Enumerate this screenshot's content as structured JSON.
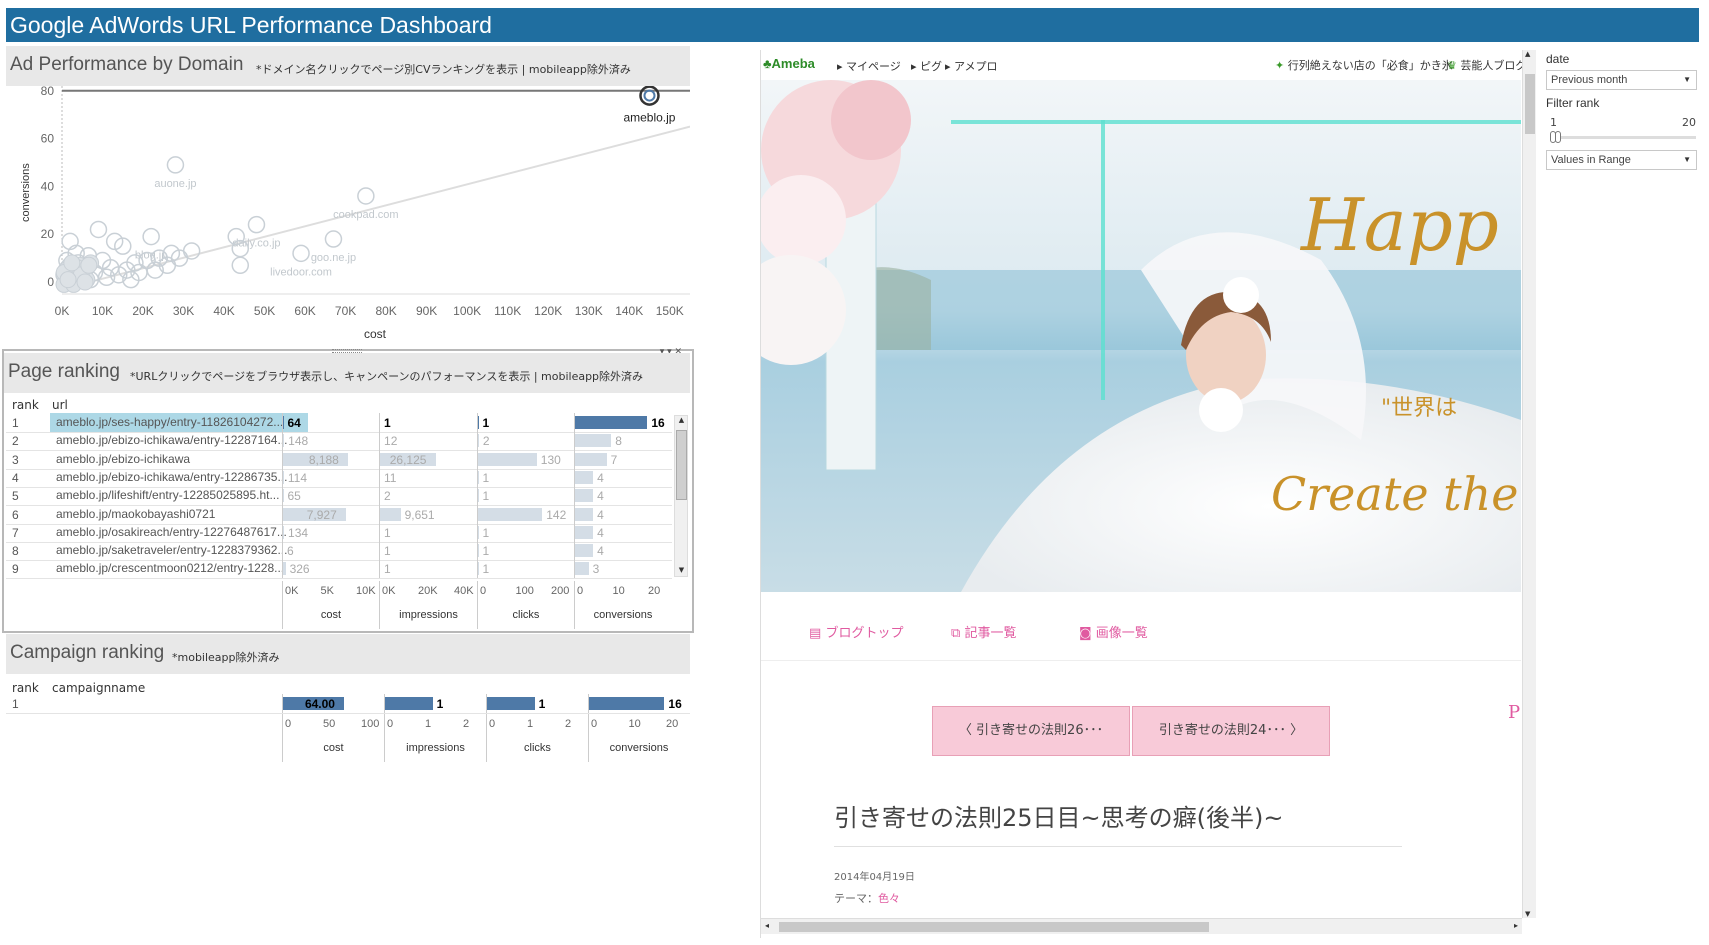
{
  "app": {
    "title": "Google AdWords URL Performance Dashboard"
  },
  "domain_panel": {
    "title": "Ad Performance by Domain",
    "subtitle": "*ドメイン名クリックでページ別CVランキングを表示 | mobileapp除外済み"
  },
  "chart_data": {
    "type": "scatter",
    "xlabel": "cost",
    "ylabel": "conversions",
    "xlim": [
      0,
      155000
    ],
    "ylim": [
      -5,
      82
    ],
    "x_ticks": [
      "0K",
      "10K",
      "20K",
      "30K",
      "40K",
      "50K",
      "60K",
      "70K",
      "80K",
      "90K",
      "100K",
      "110K",
      "120K",
      "130K",
      "140K",
      "150K"
    ],
    "y_ticks": [
      "80",
      "60",
      "40",
      "20",
      "0"
    ],
    "reference_line_y": 80,
    "trend_line": {
      "x": [
        0,
        155000
      ],
      "y": [
        -3,
        65
      ]
    },
    "highlight": {
      "label": "ameblo.jp",
      "x": 145000,
      "y": 78
    },
    "points": [
      {
        "label": "auone.jp",
        "x": 28000,
        "y": 49
      },
      {
        "label": "daily.co.jp",
        "x": 48000,
        "y": 24
      },
      {
        "label": "cookpad.com",
        "x": 75000,
        "y": 36
      },
      {
        "label": "blog.jp",
        "x": 22000,
        "y": 19
      },
      {
        "label": "goo.ne.jp",
        "x": 67000,
        "y": 18
      },
      {
        "label": "livedoor.com",
        "x": 59000,
        "y": 12
      },
      {
        "label": "",
        "x": 43000,
        "y": 19
      },
      {
        "label": "",
        "x": 44000,
        "y": 14
      },
      {
        "label": "",
        "x": 44000,
        "y": 7
      },
      {
        "label": "",
        "x": 9000,
        "y": 22
      },
      {
        "label": "",
        "x": 13000,
        "y": 17
      },
      {
        "label": "",
        "x": 15000,
        "y": 15
      },
      {
        "label": "",
        "x": 2000,
        "y": 17
      },
      {
        "label": "",
        "x": 32000,
        "y": 13
      },
      {
        "label": "",
        "x": 27000,
        "y": 12
      },
      {
        "label": "",
        "x": 24000,
        "y": 10
      },
      {
        "label": "",
        "x": 21000,
        "y": 9
      },
      {
        "label": "",
        "x": 18000,
        "y": 8
      },
      {
        "label": "",
        "x": 16000,
        "y": 5
      },
      {
        "label": "",
        "x": 12000,
        "y": 6
      },
      {
        "label": "",
        "x": 10000,
        "y": 9
      },
      {
        "label": "",
        "x": 8000,
        "y": 4
      },
      {
        "label": "",
        "x": 6000,
        "y": 6
      },
      {
        "label": "",
        "x": 5000,
        "y": 3
      },
      {
        "label": "",
        "x": 4000,
        "y": 8
      },
      {
        "label": "",
        "x": 3000,
        "y": 5
      },
      {
        "label": "",
        "x": 2500,
        "y": 2
      },
      {
        "label": "",
        "x": 2000,
        "y": 7
      },
      {
        "label": "",
        "x": 1500,
        "y": 4
      },
      {
        "label": "",
        "x": 1000,
        "y": 1
      },
      {
        "label": "",
        "x": 500,
        "y": 3
      },
      {
        "label": "",
        "x": 1200,
        "y": 9
      },
      {
        "label": "",
        "x": 7000,
        "y": 1
      },
      {
        "label": "",
        "x": 11000,
        "y": 2
      },
      {
        "label": "",
        "x": 14000,
        "y": 3
      },
      {
        "label": "",
        "x": 19000,
        "y": 4
      },
      {
        "label": "",
        "x": 23000,
        "y": 5
      },
      {
        "label": "",
        "x": 26000,
        "y": 7
      },
      {
        "label": "",
        "x": 29000,
        "y": 10
      },
      {
        "label": "",
        "x": 3500,
        "y": 12
      },
      {
        "label": "",
        "x": 6500,
        "y": 11
      },
      {
        "label": "",
        "x": 17000,
        "y": 1
      }
    ]
  },
  "page_ranking": {
    "title": "Page ranking",
    "subtitle": "*URLクリックでページをブラウザ表示し、キャンペーンのパフォーマンスを表示 | mobileapp除外済み",
    "headers": {
      "rank": "rank",
      "url": "url"
    },
    "measures": [
      "cost",
      "impressions",
      "clicks",
      "conversions"
    ],
    "axis_ticks": {
      "cost": [
        "0K",
        "5K",
        "10K"
      ],
      "impressions": [
        "0K",
        "20K",
        "40K"
      ],
      "clicks": [
        "0",
        "100",
        "200"
      ],
      "conversions": [
        "0",
        "10",
        "20"
      ]
    },
    "rows": [
      {
        "rank": "1",
        "url": "ameblo.jp/ses-happy/entry-11826104272...",
        "cost": "64",
        "impressions": "1",
        "clicks": "1",
        "conversions": "16",
        "cost_v": 64,
        "imp_v": 1,
        "clk_v": 1,
        "cv_v": 16
      },
      {
        "rank": "2",
        "url": "ameblo.jp/ebizo-ichikawa/entry-12287164...",
        "cost": "148",
        "impressions": "12",
        "clicks": "2",
        "conversions": "8",
        "cost_v": 148,
        "imp_v": 12,
        "clk_v": 2,
        "cv_v": 8
      },
      {
        "rank": "3",
        "url": "ameblo.jp/ebizo-ichikawa",
        "cost": "8,188",
        "impressions": "26,125",
        "clicks": "130",
        "conversions": "7",
        "cost_v": 8188,
        "imp_v": 26125,
        "clk_v": 130,
        "cv_v": 7
      },
      {
        "rank": "4",
        "url": "ameblo.jp/ebizo-ichikawa/entry-12286735...",
        "cost": "114",
        "impressions": "11",
        "clicks": "1",
        "conversions": "4",
        "cost_v": 114,
        "imp_v": 11,
        "clk_v": 1,
        "cv_v": 4
      },
      {
        "rank": "5",
        "url": "ameblo.jp/lifeshift/entry-12285025895.ht...",
        "cost": "65",
        "impressions": "2",
        "clicks": "1",
        "conversions": "4",
        "cost_v": 65,
        "imp_v": 2,
        "clk_v": 1,
        "cv_v": 4
      },
      {
        "rank": "6",
        "url": "ameblo.jp/maokobayashi0721",
        "cost": "7,927",
        "impressions": "9,651",
        "clicks": "142",
        "conversions": "4",
        "cost_v": 7927,
        "imp_v": 9651,
        "clk_v": 142,
        "cv_v": 4
      },
      {
        "rank": "7",
        "url": "ameblo.jp/osakireach/entry-12276487617...",
        "cost": "134",
        "impressions": "1",
        "clicks": "1",
        "conversions": "4",
        "cost_v": 134,
        "imp_v": 1,
        "clk_v": 1,
        "cv_v": 4
      },
      {
        "rank": "8",
        "url": "ameblo.jp/saketraveler/entry-1228379362...",
        "cost": "6",
        "impressions": "1",
        "clicks": "1",
        "conversions": "4",
        "cost_v": 6,
        "imp_v": 1,
        "clk_v": 1,
        "cv_v": 4
      },
      {
        "rank": "9",
        "url": "ameblo.jp/crescentmoon0212/entry-1228...",
        "cost": "326",
        "impressions": "1",
        "clicks": "1",
        "conversions": "3",
        "cost_v": 326,
        "imp_v": 1,
        "clk_v": 1,
        "cv_v": 3
      }
    ]
  },
  "campaign_ranking": {
    "title": "Campaign ranking",
    "subtitle": "*mobileapp除外済み",
    "headers": {
      "rank": "rank",
      "name": "campaignname"
    },
    "measures": [
      "cost",
      "impressions",
      "clicks",
      "conversions"
    ],
    "row": {
      "rank": "1",
      "cost": "64.00",
      "impressions": "1",
      "clicks": "1",
      "conversions": "16",
      "cost_v": 64,
      "imp_v": 1,
      "clk_v": 1,
      "cv_v": 16
    },
    "axis_ticks": {
      "cost": [
        "0",
        "50",
        "100"
      ],
      "impressions": [
        "0",
        "1",
        "2"
      ],
      "clicks": [
        "0",
        "1",
        "2"
      ],
      "conversions": [
        "0",
        "10",
        "20"
      ]
    }
  },
  "browser": {
    "brand": "Ameba",
    "nav": [
      "マイページ",
      "ピグ",
      "アメプロ"
    ],
    "promo": "行列絶えない店の「必食」かき氷",
    "promo2": "芸能人ブログ",
    "hero_script_1": "Happ",
    "hero_script_2": "Create the u",
    "hero_jp": "\"世界は",
    "tabs": [
      "ブログトップ",
      "記事一覧",
      "画像一覧"
    ],
    "prev_button": "引き寄せの法則26･･･",
    "next_button": "引き寄せの法則24･･･",
    "post_title": "引き寄せの法則25日目~思考の癖(後半)~",
    "post_date": "2014年04月19日",
    "theme_label": "テーマ：",
    "theme_value": "色々",
    "side_letter": "P"
  },
  "filters": {
    "date_label": "date",
    "date_value": "Previous month",
    "rank_label": "Filter rank",
    "rank_min": "1",
    "rank_max": "20",
    "range_mode": "Values in Range"
  },
  "colors": {
    "title_bar": "#1f6ea0",
    "bar_dark": "#4e79a7",
    "bar_light": "#d4dde6",
    "selection": "#add8e6",
    "pink_button": "#f8cad8",
    "pink_text": "#e05aa0"
  }
}
